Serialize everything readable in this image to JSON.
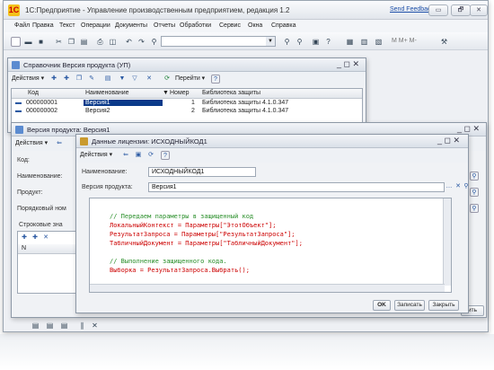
{
  "app": {
    "title": "1С:Предприятие - Управление производственным предприятием, редакция 1.2",
    "send_feedback": "Send Feedback",
    "window_buttons": [
      "▭",
      "🗗",
      "✕"
    ]
  },
  "menu": [
    "Файл",
    "Правка",
    "Текст",
    "Операции",
    "Документы",
    "Отчеты",
    "Обработки",
    "Сервис",
    "Окна",
    "Справка"
  ],
  "toolbar": {
    "m_labels": "M  M+  M-"
  },
  "catalog_window": {
    "title": "Справочник Версия продукта (УП)",
    "controls": "_ ◻ ✕",
    "actions_label": "Действия ▾",
    "goto_label": "Перейти ▾",
    "help": "?",
    "columns": [
      "Код",
      "Наименование",
      "Номер",
      "Библиотека защиты"
    ],
    "rows": [
      {
        "code": "000000001",
        "name": "Версия1",
        "number": "1",
        "lib": "Библиотека защиты 4.1.0.347"
      },
      {
        "code": "000000002",
        "name": "Версия2",
        "number": "2",
        "lib": "Библиотека защиты 4.1.0.347"
      }
    ]
  },
  "product_window": {
    "title": "Версия продукта: Версия1",
    "controls": "_ ◻ ✕",
    "actions_label": "Действия ▾",
    "labels": [
      "Код:",
      "Наименование:",
      "Продукт:",
      "Порядковый ном"
    ],
    "string_values_label": "Строковые зна",
    "grid_header": "N"
  },
  "license_window": {
    "title": "Данные лицензии: ИСХОДНЫЙКОД1",
    "controls": "_ ◻ ✕",
    "actions_label": "Действия ▾",
    "help": "?",
    "name_label": "Наименование:",
    "name_value": "ИСХОДНЫЙКОД1",
    "version_label": "Версия продукта:",
    "version_value": "Версия1",
    "code": [
      {
        "text": "// Передаем параметры в защищенный код",
        "comment": true
      },
      {
        "text": "ЛокальныйКонтекст = Параметры[\"ЭтотОбъект\"];",
        "comment": false
      },
      {
        "text": "РезультатЗапроса = Параметры[\"РезультатЗапроса\"];",
        "comment": false
      },
      {
        "text": "ТабличныйДокумент = Параметры[\"ТабличныйДокумент\"];",
        "comment": false
      },
      {
        "text": "",
        "comment": false
      },
      {
        "text": "// Выполнение защищенного кода.",
        "comment": true
      },
      {
        "text": "Выборка = РезультатЗапроса.Выбрать();",
        "comment": false
      }
    ],
    "ok_label": "OK",
    "save_label": "Записать",
    "close_label": "Закрыть"
  },
  "bottom_tab": "ить"
}
